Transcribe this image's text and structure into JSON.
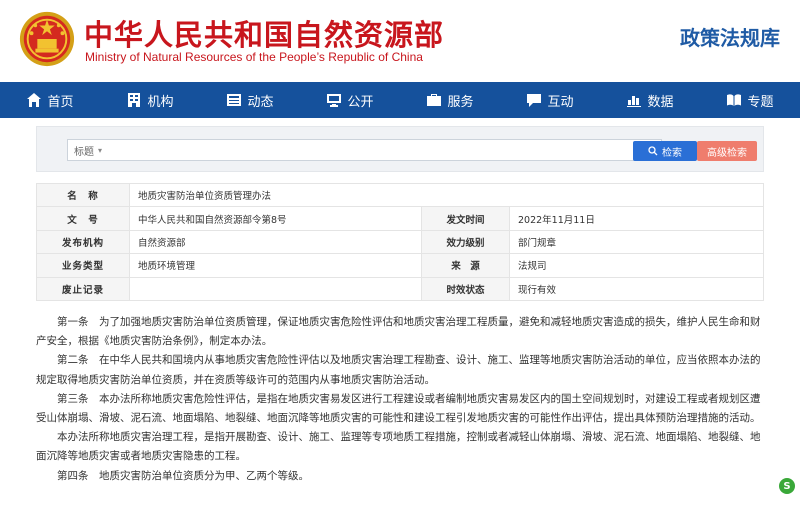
{
  "header": {
    "brand_cn": "中华人民共和国自然资源部",
    "brand_en": "Ministry of Natural Resources of the People’s Republic of China",
    "library_title": "政策法规库",
    "emblem_icon": "national-emblem-icon"
  },
  "nav": {
    "items": [
      {
        "label": "首页",
        "icon": "home-icon"
      },
      {
        "label": "机构",
        "icon": "building-icon"
      },
      {
        "label": "动态",
        "icon": "news-icon"
      },
      {
        "label": "公开",
        "icon": "monitor-icon"
      },
      {
        "label": "服务",
        "icon": "briefcase-icon"
      },
      {
        "label": "互动",
        "icon": "chat-icon"
      },
      {
        "label": "数据",
        "icon": "chart-icon"
      },
      {
        "label": "专题",
        "icon": "book-icon"
      }
    ]
  },
  "search": {
    "field_selected": "标题",
    "search_label": "检索",
    "advanced_label": "高级检索"
  },
  "meta": {
    "name_label": "名　称",
    "name_value": "地质灾害防治单位资质管理办法",
    "docno_label": "文　号",
    "docno_value": "中华人民共和国自然资源部令第8号",
    "date_label": "发文时间",
    "date_value": "2022年11月11日",
    "org_label": "发布机构",
    "org_value": "自然资源部",
    "level_label": "效力级别",
    "level_value": "部门规章",
    "type_label": "业务类型",
    "type_value": "地质环境管理",
    "source_label": "来　源",
    "source_value": "法规司",
    "abolish_label": "废止记录",
    "abolish_value": "",
    "status_label": "时效状态",
    "status_value": "现行有效"
  },
  "article": {
    "paragraphs": [
      "第一条　为了加强地质灾害防治单位资质管理，保证地质灾害危险性评估和地质灾害治理工程质量，避免和减轻地质灾害造成的损失，维护人民生命和财产安全，根据《地质灾害防治条例》，制定本办法。",
      "第二条　在中华人民共和国境内从事地质灾害危险性评估以及地质灾害治理工程勘查、设计、施工、监理等地质灾害防治活动的单位，应当依照本办法的规定取得地质灾害防治单位资质，并在资质等级许可的范围内从事地质灾害防治活动。",
      "第三条　本办法所称地质灾害危险性评估，是指在地质灾害易发区进行工程建设或者编制地质灾害易发区内的国土空间规划时，对建设工程或者规划区遭受山体崩塌、滑坡、泥石流、地面塌陷、地裂缝、地面沉降等地质灾害的可能性和建设工程引发地质灾害的可能性作出评估，提出具体预防治理措施的活动。",
      "本办法所称地质灾害治理工程，是指开展勘查、设计、施工、监理等专项地质工程措施，控制或者减轻山体崩塌、滑坡、泥石流、地面塌陷、地裂缝、地面沉降等地质灾害或者地质灾害隐患的工程。",
      "第四条　地质灾害防治单位资质分为甲、乙两个等级。"
    ]
  },
  "corner_badge": {
    "letter": "S",
    "icon": "input-method-icon"
  },
  "colors": {
    "brand_red": "#c8161d",
    "nav_blue": "#15519c",
    "title_blue": "#1f5ba5",
    "search_btn": "#2a6fd6",
    "advanced_btn": "#ef7d6d"
  }
}
